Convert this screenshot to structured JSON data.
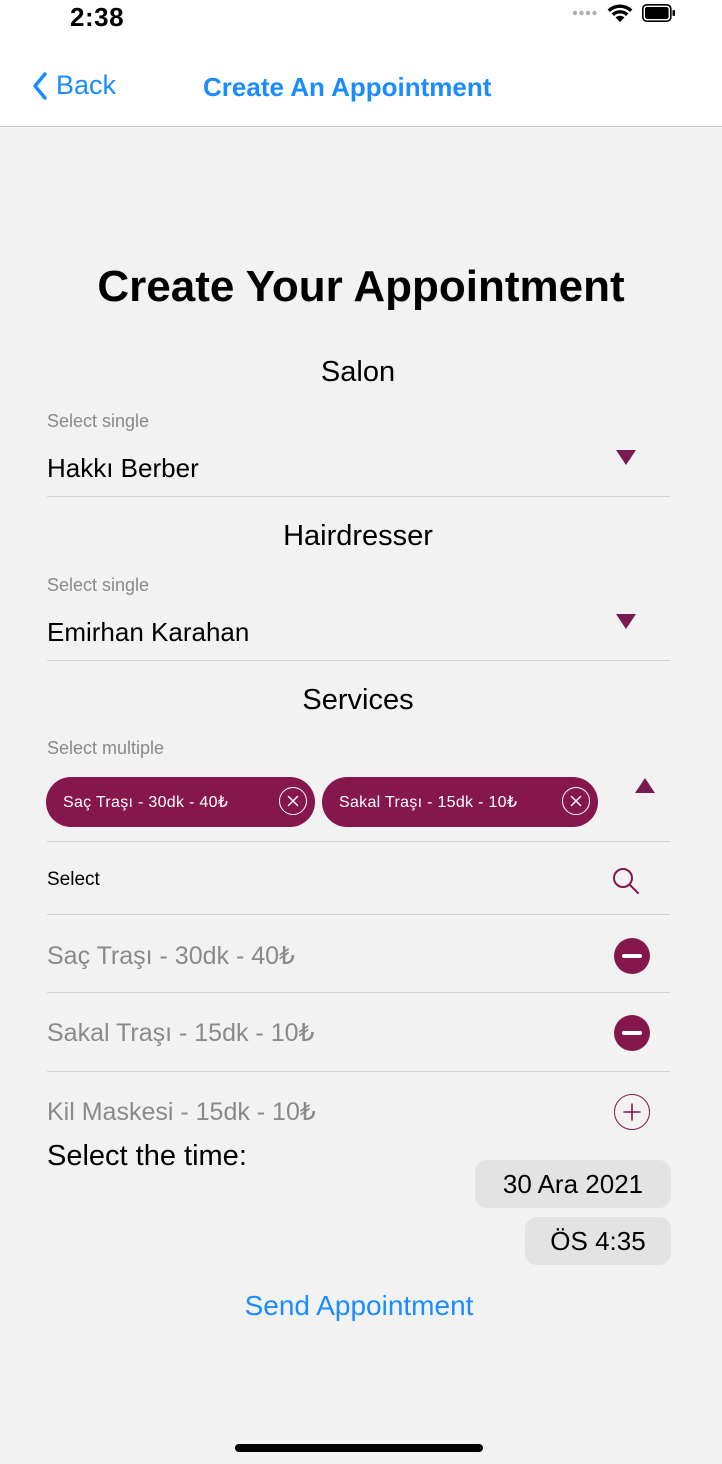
{
  "status": {
    "time": "2:38"
  },
  "nav": {
    "back_label": "Back",
    "title": "Create An Appointment"
  },
  "page": {
    "title": "Create Your Appointment"
  },
  "salon": {
    "title": "Salon",
    "hint": "Select single",
    "value": "Hakkı Berber"
  },
  "hairdresser": {
    "title": "Hairdresser",
    "hint": "Select single",
    "value": "Emirhan Karahan"
  },
  "services": {
    "title": "Services",
    "hint": "Select multiple",
    "chips": [
      "Saç Traşı - 30dk - 40₺",
      "Sakal Traşı - 15dk - 10₺"
    ],
    "select_label": "Select",
    "options": [
      {
        "label": "Saç Traşı - 30dk - 40₺",
        "selected": true
      },
      {
        "label": "Sakal Traşı - 15dk - 10₺",
        "selected": true
      },
      {
        "label": "Kil Maskesi - 15dk - 10₺",
        "selected": false
      }
    ]
  },
  "time": {
    "label": "Select the time:",
    "date": "30 Ara 2021",
    "clock": "ÖS 4:35"
  },
  "send_label": "Send Appointment",
  "colors": {
    "accent": "#86174d",
    "link": "#1a8cff",
    "background": "#f2f2f2"
  }
}
